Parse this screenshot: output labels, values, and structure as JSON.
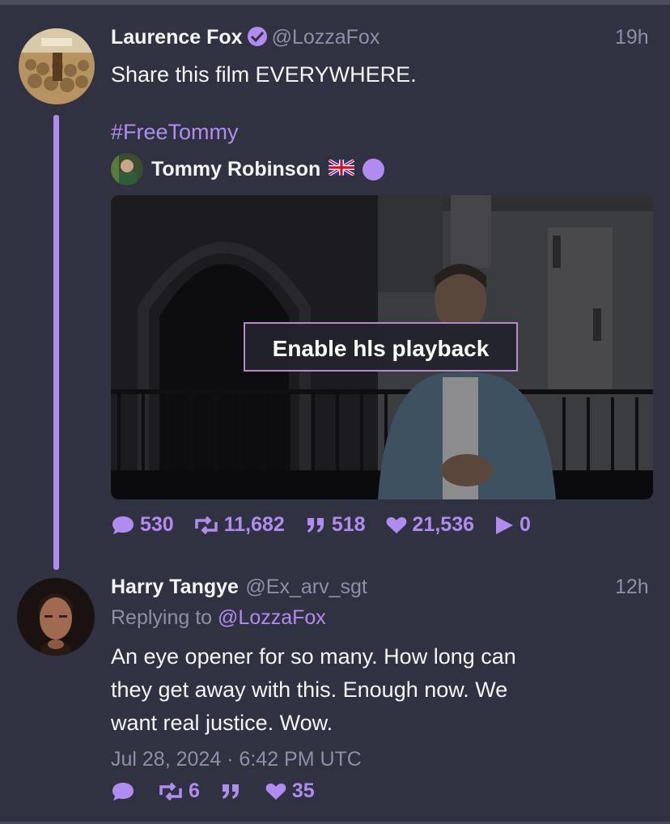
{
  "post1": {
    "author_name": "Laurence Fox",
    "handle": "@LozzaFox",
    "time": "19h",
    "text": "Share this film EVERYWHERE.",
    "hashtag": "#FreeTommy",
    "quoted": {
      "author_name": "Tommy Robinson",
      "flag": "🇬🇧"
    },
    "video": {
      "button_label": "Enable hls playback"
    },
    "stats": {
      "replies": "530",
      "reposts": "11,682",
      "quotes": "518",
      "likes": "21,536",
      "plays": "0"
    }
  },
  "post2": {
    "author_name": "Harry Tangye",
    "handle": "@Ex_arv_sgt",
    "time": "12h",
    "replying_prefix": "Replying to",
    "replying_to": "@LozzaFox",
    "text_lines": [
      "An eye opener for so many.  How long  can",
      "they get away with this.  Enough now.  We",
      "want real justice.  Wow."
    ],
    "timestamp": "Jul 28, 2024 · 6:42 PM UTC",
    "stats": {
      "replies": "",
      "reposts": "6",
      "quotes": "",
      "likes": "35"
    }
  },
  "colors": {
    "background": "#303241",
    "accent": "#b18cf0",
    "muted": "#8d90a8"
  },
  "icons": [
    "verified-badge-icon",
    "reply-icon",
    "retweet-icon",
    "quote-icon",
    "heart-icon",
    "play-icon"
  ]
}
